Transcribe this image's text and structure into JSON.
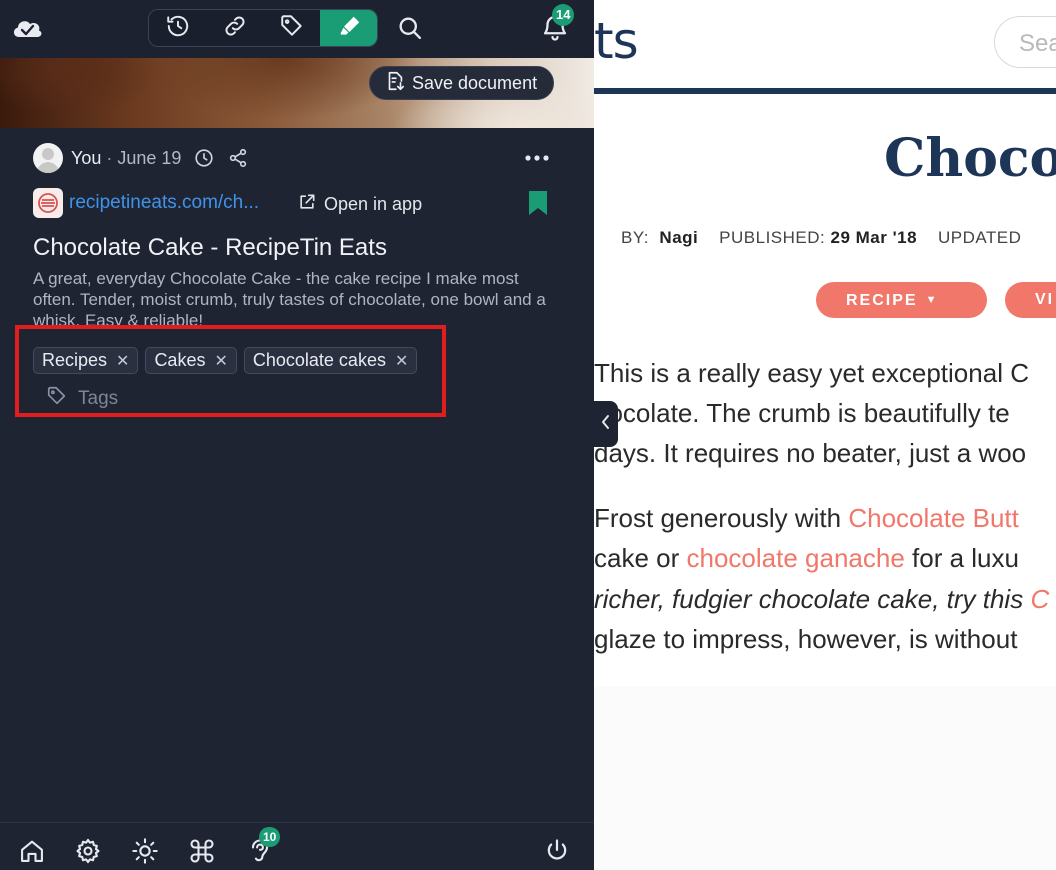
{
  "site": {
    "logo_fragment": "ts",
    "search_placeholder": "Sea",
    "title_fragment": "Chocol",
    "byline": {
      "by_label": "BY:",
      "author": "Nagi",
      "published_label": "PUBLISHED:",
      "published_date": "29 Mar '18",
      "updated_label": "UPDATED"
    },
    "buttons": {
      "recipe": "RECIPE",
      "video": "VI"
    },
    "paragraph1": [
      "This is a really easy yet exceptional C",
      "hocolate. The crumb is beautifully te",
      "days. It requires no beater, just a woo"
    ],
    "paragraph2": {
      "line1_text": "Frost generously with ",
      "line1_link": "Chocolate Butt",
      "line2_text_a": "cake or ",
      "line2_link": "chocolate ganache",
      "line2_text_b": " for a luxu",
      "line3_italic": "richer, fudgier chocolate cake, try this ",
      "line3_link": "C",
      "line4_text": "glaze to impress, however, is without"
    }
  },
  "panel": {
    "notifications_count": "14",
    "save_document_label": "Save document",
    "meta": {
      "author": "You",
      "separator": "·",
      "date": "June 19"
    },
    "source": {
      "link_text": "recipetineats.com/ch...",
      "open_in_app_label": "Open in app"
    },
    "document": {
      "title": "Chocolate Cake - RecipeTin Eats",
      "description": "A great, everyday Chocolate Cake - the cake recipe I make most often. Tender, moist crumb, truly tastes of chocolate, one bowl and a whisk. Easy & reliable!"
    },
    "tags": [
      "Recipes",
      "Cakes",
      "Chocolate cakes"
    ],
    "tag_input_placeholder": "Tags",
    "bottom_badge_count": "10"
  },
  "colors": {
    "accent": "#1a9d74",
    "panel_bg": "#1f2433",
    "link": "#3f93e8",
    "site_accent": "#f0776a",
    "site_navy": "#1d3557",
    "highlight": "#e11d1d"
  },
  "icons": [
    "cloud-check-icon",
    "history-icon",
    "link-icon",
    "tag-icon",
    "highlighter-icon",
    "search-icon",
    "bell-icon",
    "document-download-icon",
    "clock-icon",
    "share-icon",
    "more-icon",
    "external-link-icon",
    "bookmark-icon",
    "home-icon",
    "settings-icon",
    "sun-icon",
    "command-icon",
    "ear-icon",
    "power-icon",
    "chevron-left-icon"
  ]
}
